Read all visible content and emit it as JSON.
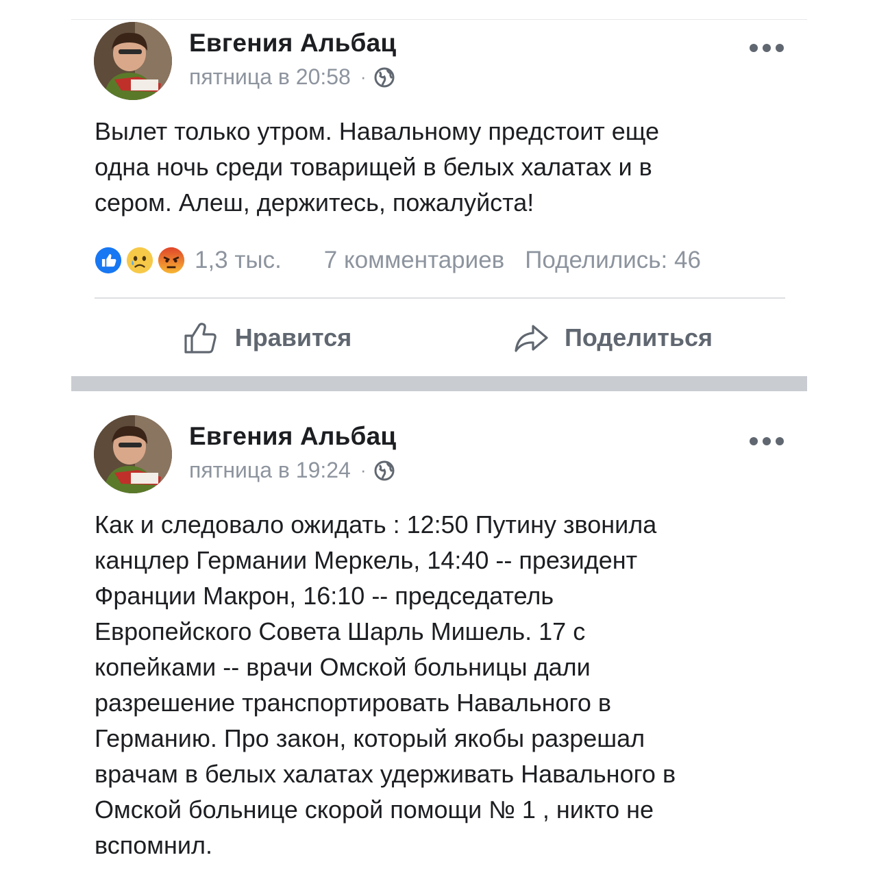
{
  "posts": [
    {
      "author": "Евгения Альбац",
      "time": "пятница в 20:58",
      "separator": "·",
      "text": "Вылет только утром. Навальному предстоит еще\nодна ночь среди товарищей в белых халатах и в\nсером. Алеш, держитесь, пожалуйста!",
      "reactions_count": "1,3 тыс.",
      "comments": "7 комментариев",
      "shares": "Поделились: 46",
      "reaction_icons": [
        "like-reaction",
        "sad-reaction",
        "angry-reaction"
      ],
      "actions": {
        "like": "Нравится",
        "share": "Поделиться"
      }
    },
    {
      "author": "Евгения Альбац",
      "time": "пятница в 19:24",
      "separator": "·",
      "text": "Как и следовало ожидать : 12:50 Путину звонила\nканцлер Германии Меркель, 14:40 -- президент\nФранции Макрон, 16:10 -- председатель\nЕвропейского Совета Шарль Мишель. 17 с\nкопейками -- врачи Омской больницы дали\nразрешение транспортировать Навального в\nГерманию. Про закон, который якобы разрешал\nврачам в белых халатах удерживать Навального в\nОмской больнице скорой помощи № 1  , никто не\nвспомнил."
    }
  ],
  "colors": {
    "text": "#1c1e21",
    "secondary": "#8d949e",
    "action": "#606770",
    "like_blue": "#1877f2",
    "separator": "#c9ccd1"
  }
}
